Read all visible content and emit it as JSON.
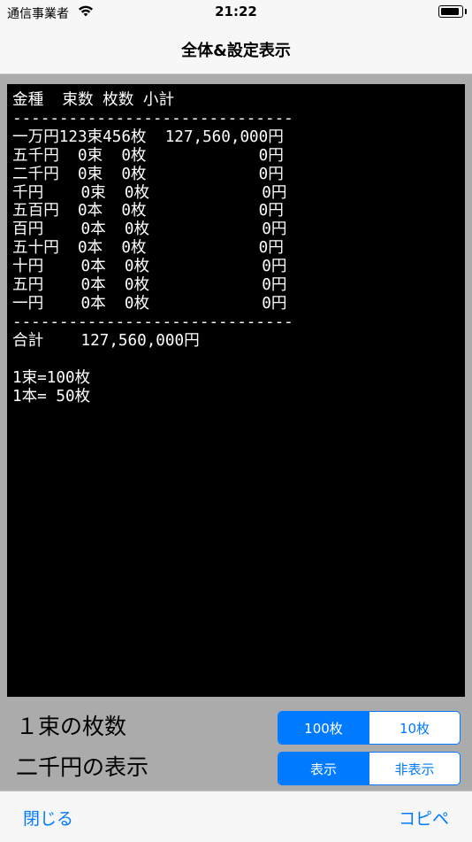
{
  "status_bar": {
    "carrier": "通信事業者",
    "time": "21:22"
  },
  "nav": {
    "title": "全体&設定表示"
  },
  "report": {
    "lines": [
      "金種  束数 枚数 小計",
      "------------------------------",
      "一万円123束456枚  127,560,000円",
      "五千円  0束  0枚            0円",
      "二千円  0束  0枚            0円",
      "千円    0束  0枚            0円",
      "五百円  0本  0枚            0円",
      "百円    0本  0枚            0円",
      "五十円  0本  0枚            0円",
      "十円    0本  0枚            0円",
      "五円    0本  0枚            0円",
      "一円    0本  0枚            0円",
      "------------------------------",
      "合計    127,560,000円",
      "",
      "1束=100枚",
      "1本= 50枚"
    ]
  },
  "settings": {
    "bundle_count": {
      "label": "１束の枚数",
      "options": [
        "100枚",
        "10枚"
      ],
      "selected_index": 0
    },
    "two_thousand_display": {
      "label": "二千円の表示",
      "options": [
        "表示",
        "非表示"
      ],
      "selected_index": 0
    }
  },
  "toolbar": {
    "close_label": "閉じる",
    "copy_label": "コピペ"
  },
  "colors": {
    "accent": "#007aff",
    "screen_bg": "#000000",
    "page_bg": "#ababab"
  }
}
